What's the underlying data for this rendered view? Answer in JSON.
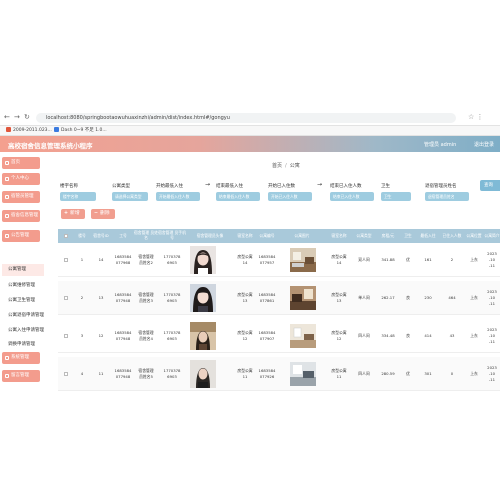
{
  "browser": {
    "back": "←",
    "forward": "→",
    "reload": "↻",
    "url": "localhost:8080/springbootaowuhuaxinzhi/admin/dist/index.html#/gongyu",
    "tabs": [
      "2009-2011.023...",
      "Dash 0~9  不足 1.0..."
    ],
    "right": "☆  ⋮"
  },
  "header": {
    "title": "高校宿舍信息管理系统小程序",
    "user": "管理员 admin",
    "exit": "退出登录"
  },
  "sidebar": {
    "items": [
      {
        "label": "首页"
      },
      {
        "label": "个人中心"
      },
      {
        "label": "宿管员管理"
      },
      {
        "label": "宿舍信息管理"
      },
      {
        "label": "公告管理"
      }
    ],
    "submenu": [
      {
        "label": "公寓管理"
      },
      {
        "label": "公寓维修管理"
      },
      {
        "label": "公寓卫生管理"
      },
      {
        "label": "公寓退宿申请管理"
      },
      {
        "label": "公寓入住申请管理"
      },
      {
        "label": "调换申请管理"
      }
    ],
    "bottom": [
      {
        "label": "系统管理"
      },
      {
        "label": "留言管理"
      }
    ]
  },
  "breadcrumb": {
    "home": "首页",
    "sep": "/",
    "current": "公寓"
  },
  "filters": {
    "labels": [
      "楼宇名称",
      "公寓类型",
      "开始最低入住",
      "结束最低入住",
      "开始已入住数",
      "结束已入住人数",
      "卫生",
      "退宿管理员姓名"
    ],
    "placeholders": [
      "楼宇名称",
      "请选择公寓类型",
      "开始最低入住人数",
      "结束最低入住人数",
      "开始已入住人数",
      "结束已入住人数",
      "卫生",
      "退宿管理员姓名"
    ],
    "arrow": "→",
    "search": "查询"
  },
  "actions": {
    "add": "新增",
    "delete": "删除",
    "plus": "+",
    "minus": "−"
  },
  "table": {
    "columns": [
      "楼号",
      "宿舍号",
      "宿舍号ID",
      "工号",
      "宿舍管理\n员姓名",
      "宿舍管理\n员手机号",
      "宿舍管理员头像",
      "寝室名称",
      "公寓编号",
      "公寓图片",
      "寝室名称",
      "公寓类型",
      "房租/元",
      "卫生",
      "最低入住",
      "已住入人数",
      "公寓位置",
      "公寓简介"
    ],
    "rows": [
      {
        "idx": "1",
        "floor": "14",
        "room_id": "14",
        "job_no": "1683584\n077968",
        "manager": "宿舍管理\n员姓名2",
        "phone": "1770378\n6903",
        "room_name": "房型公寓\n14",
        "apt_no": "1683584\n077957",
        "room_name2": "房型公寓\n14",
        "type": "双人间",
        "rent": "341.88",
        "hygiene": "优",
        "min": "161",
        "count": "2",
        "location": "上东",
        "intro": "2023\n-10\n-11"
      },
      {
        "idx": "2",
        "floor": "13",
        "room_id": "13",
        "job_no": "1683584\n077948",
        "manager": "宿舍管理\n员姓名3",
        "phone": "1770378\n6903",
        "room_name": "房型公寓\n13",
        "apt_no": "1683584\n077861",
        "room_name2": "房型公寓\n13",
        "type": "单人间",
        "rent": "262.17",
        "hygiene": "良",
        "min": "230",
        "count": "464",
        "location": "上东",
        "intro": "2023\n-10\n-11"
      },
      {
        "idx": "3",
        "floor": "12",
        "room_id": "12",
        "job_no": "1683584\n077948",
        "manager": "宿舍管理\n员姓名4",
        "phone": "1770378\n6903",
        "room_name": "房型公寓\n12",
        "apt_no": "1683584\n077907",
        "room_name2": "房型公寓\n12",
        "type": "四人间",
        "rent": "334.48",
        "hygiene": "良",
        "min": "414",
        "count": "43",
        "location": "上东",
        "intro": "2023\n-10\n-11"
      },
      {
        "idx": "4",
        "floor": "11",
        "room_id": "11",
        "job_no": "1683584\n077948",
        "manager": "宿舍管理\n员姓名5",
        "phone": "1770378\n6903",
        "room_name": "房型公寓\n11",
        "apt_no": "1683584\n077926",
        "room_name2": "房型公寓\n11",
        "type": "四人间",
        "rent": "280.59",
        "hygiene": "优",
        "min": "301",
        "count": "0",
        "location": "上东",
        "intro": "2023\n-10\n-11"
      }
    ]
  },
  "colors": {
    "accent": "#f39c8d",
    "header_grad_end": "#7eaec7",
    "table_head": "#a9c9da",
    "input_bg": "#9ecce0"
  },
  "icons": [
    "menu-square-icon",
    "plus-icon",
    "minus-icon",
    "arrow-right-icon"
  ]
}
